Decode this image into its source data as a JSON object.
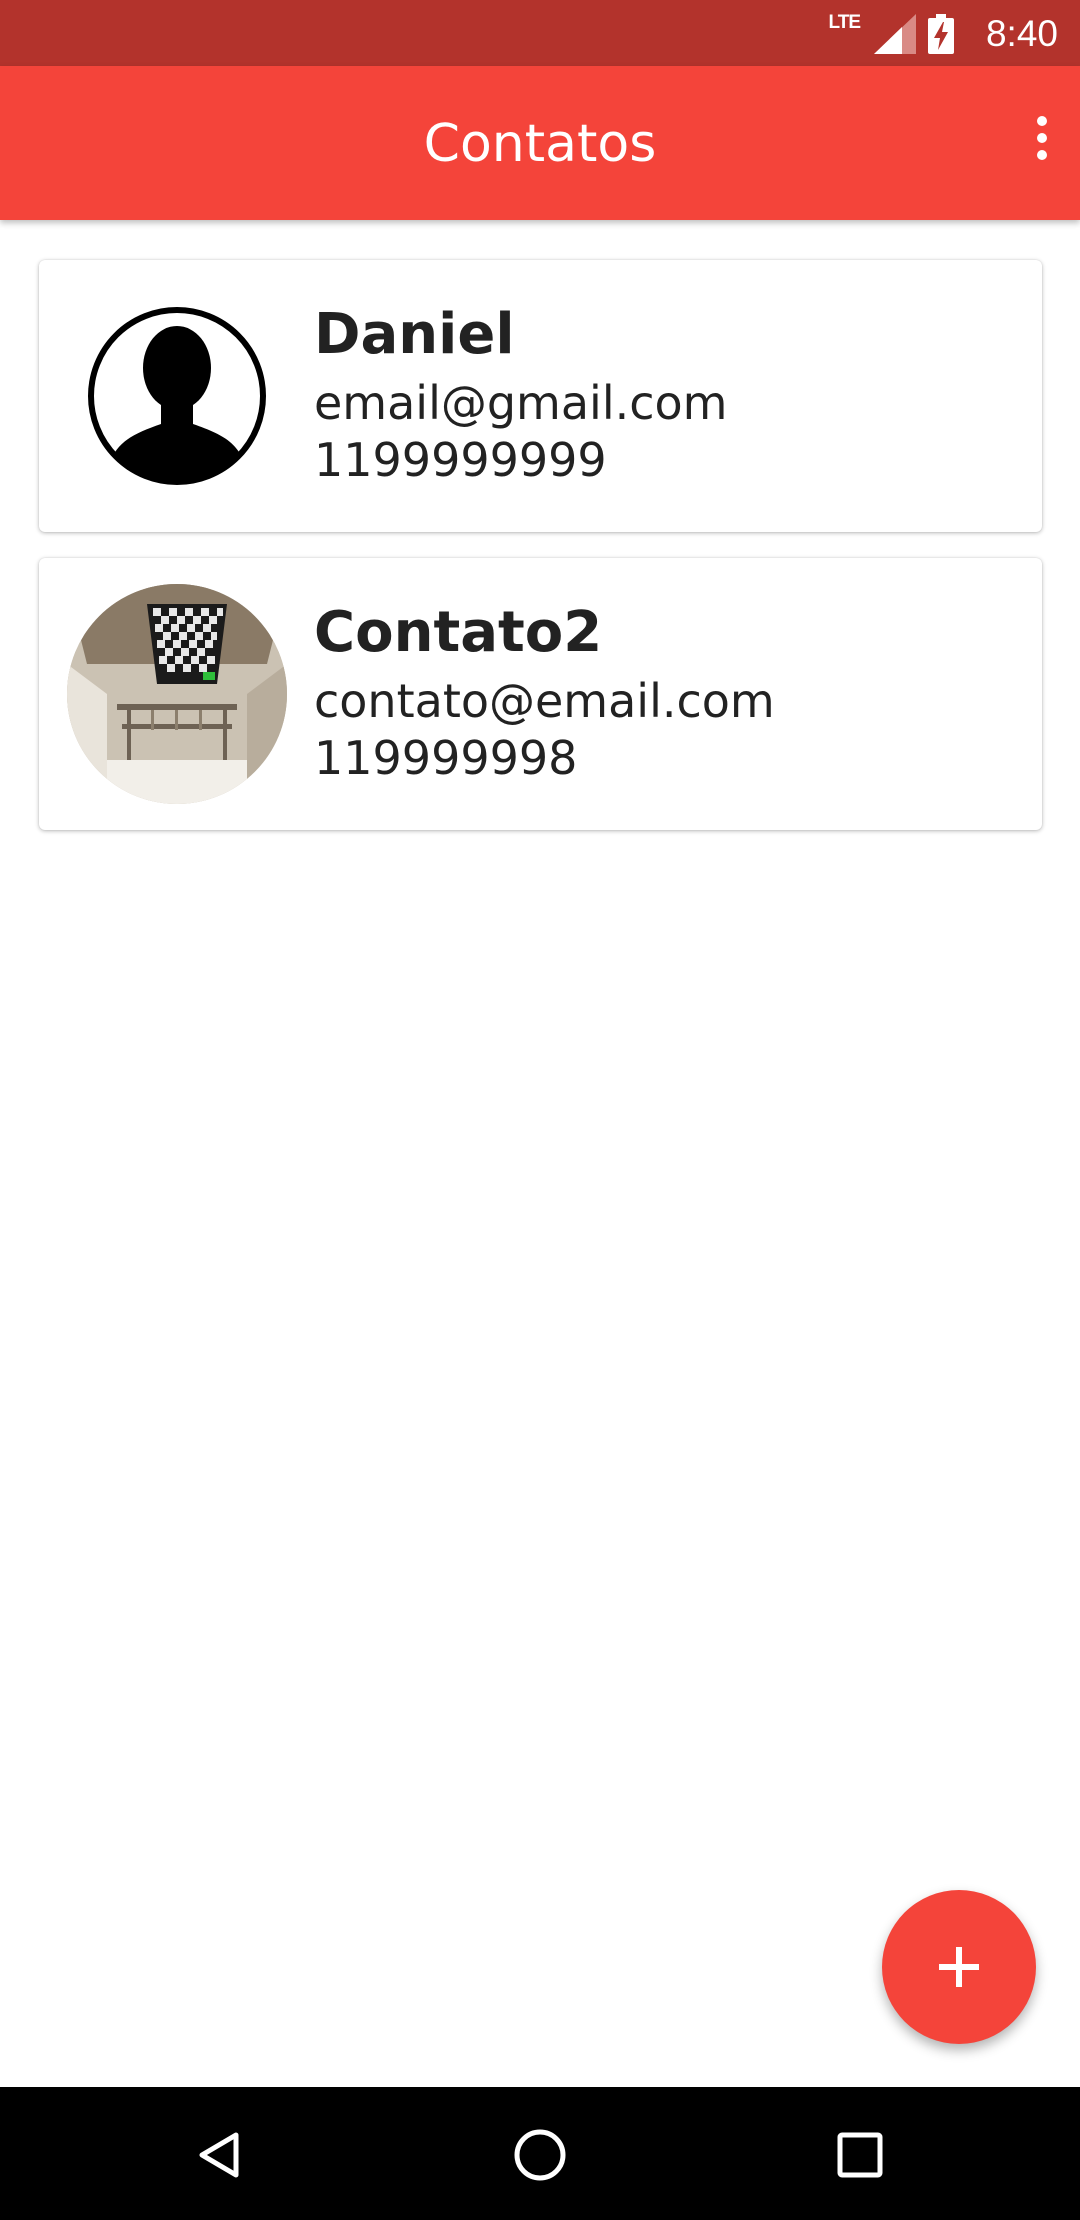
{
  "status_bar": {
    "network": "LTE",
    "time": "8:40",
    "icons": [
      "lte-icon",
      "signal-icon",
      "battery-charging-icon"
    ]
  },
  "app_bar": {
    "title": "Contatos",
    "menu_icon": "overflow-menu-icon"
  },
  "contacts": [
    {
      "name": "Daniel",
      "email": "email@gmail.com",
      "phone": "1199999999",
      "avatar": "default-person-icon"
    },
    {
      "name": "Contato2",
      "email": "contato@email.com",
      "phone": "119999998",
      "avatar": "contact-photo"
    }
  ],
  "fab": {
    "icon": "add-icon",
    "color": "#f4443a"
  },
  "nav_bar": {
    "icons": [
      "back-icon",
      "home-icon",
      "recents-icon"
    ]
  },
  "colors": {
    "primary": "#f4443a",
    "primary_dark": "#b3332c",
    "text": "#222222"
  }
}
